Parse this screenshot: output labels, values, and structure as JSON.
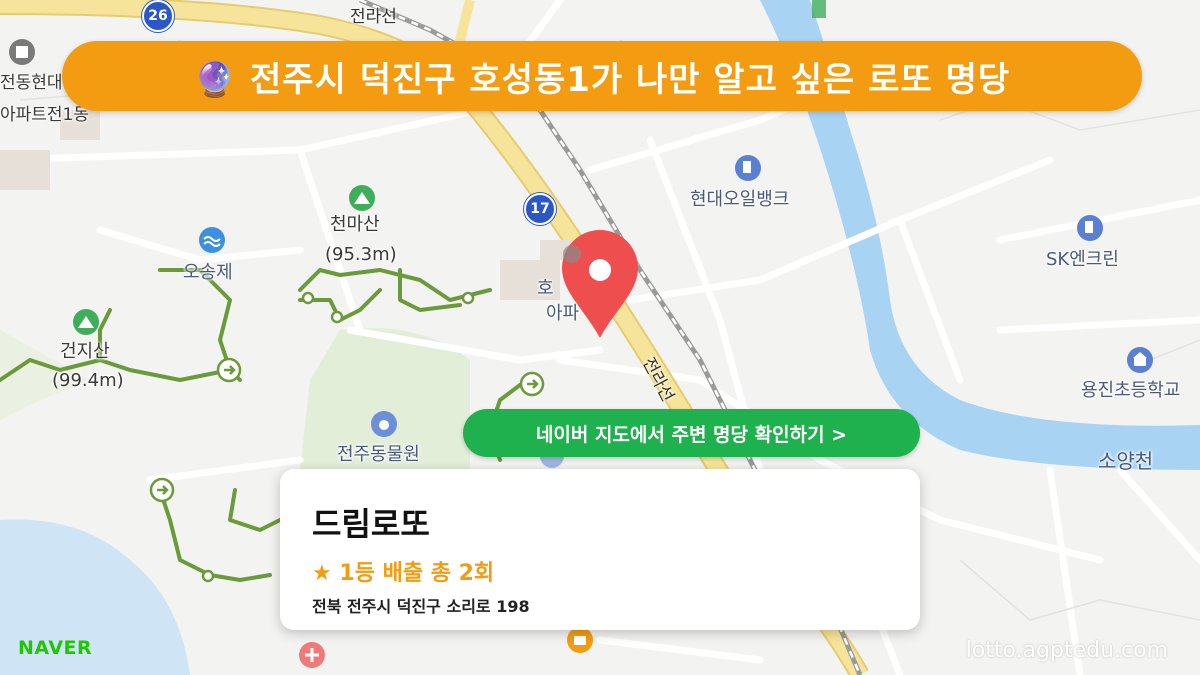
{
  "banner": {
    "title": "🔮 전주시 덕진구 호성동1가 나만 알고 싶은 로또 명당"
  },
  "map": {
    "provider_logo": "NAVER",
    "watermark": "lotto.agptedu.com",
    "route_badges": [
      "26",
      "17"
    ],
    "rail_labels": [
      "전라선",
      "전라선"
    ],
    "places": {
      "mountain1_name": "천마산",
      "mountain1_height": "(95.3m)",
      "mountain2_name": "건지산",
      "mountain2_height": "(99.4m)",
      "reservoir": "오송제",
      "gas1": "현대오일뱅크",
      "gas2": "SK엔크린",
      "school": "용진초등학교",
      "river": "소양천",
      "zoo": "전주동물원",
      "apt_partial_1": "호",
      "apt_partial_2": "아파",
      "top_left_1": "전동현대",
      "top_left_2": "아파트전1동"
    },
    "icons": [
      "mountain-icon",
      "mountain-icon",
      "water-icon",
      "gas-station-icon",
      "gas-station-icon",
      "school-icon",
      "zoo-icon",
      "location-pin-icon",
      "hospital-icon",
      "shopping-icon",
      "trail-arrow-icon"
    ],
    "colors": {
      "river": "#a9d3f2",
      "road_major": "#f7e49b",
      "park": "#e2efd6",
      "trail": "#6b9a3a",
      "pin": "#ef4e4e"
    }
  },
  "cta": {
    "label": "네이버 지도에서 주변 명당 확인하기 >"
  },
  "store": {
    "name": "드림로또",
    "win_text": "★ 1등 배출 총 2회",
    "address": "전북 전주시 덕진구 소리로 198"
  },
  "theme": {
    "accent": "#f39c12",
    "cta": "#1fb14d"
  }
}
